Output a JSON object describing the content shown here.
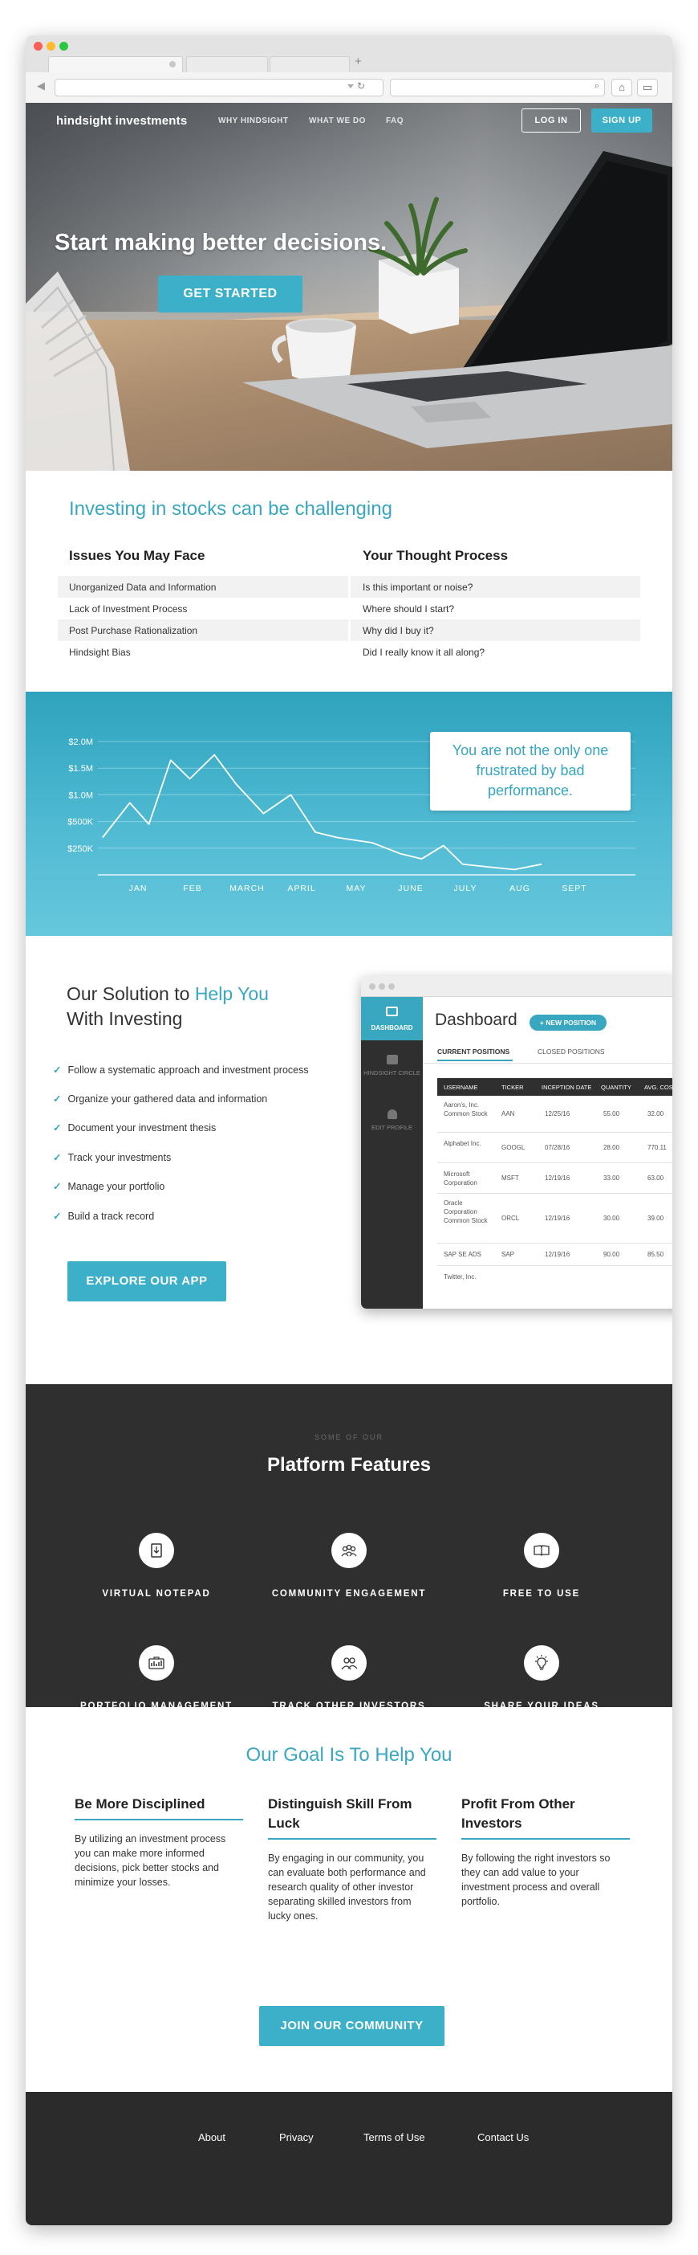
{
  "nav": {
    "logo": "hindsight investments",
    "links": [
      "WHY HINDSIGHT",
      "WHAT WE DO",
      "FAQ"
    ],
    "login": "LOG IN",
    "signup": "SIGN UP"
  },
  "hero": {
    "headline": "Start making better decisions.",
    "cta": "GET STARTED"
  },
  "challenges": {
    "heading": "Investing in stocks can be challenging",
    "col_left": "Issues You May Face",
    "col_right": "Your Thought Process",
    "rows": [
      {
        "issue": "Unorganized Data and Information",
        "thought": "Is this important or noise?"
      },
      {
        "issue": "Lack of Investment Process",
        "thought": "Where should I start?"
      },
      {
        "issue": "Post Purchase Rationalization",
        "thought": "Why did I buy it?"
      },
      {
        "issue": "Hindsight Bias",
        "thought": "Did I really know it all along?"
      }
    ]
  },
  "frustration": {
    "callout": "You are not the only one frustrated by bad performance."
  },
  "chart_data": {
    "type": "line",
    "title": "",
    "xlabel": "",
    "ylabel": "",
    "y_ticks": [
      "$2.0M",
      "$1.5M",
      "$1.0M",
      "$500K",
      "$250K"
    ],
    "y_tick_values": [
      2000000,
      1500000,
      1000000,
      500000,
      0
    ],
    "ylim": [
      0,
      2000000
    ],
    "x_ticks": [
      "JAN",
      "FEB",
      "MARCH",
      "APRIL",
      "MAY",
      "JUNE",
      "JULY",
      "AUG",
      "SEPT"
    ],
    "x": [
      0.35,
      0.85,
      1.2,
      1.6,
      1.95,
      2.4,
      2.8,
      3.3,
      3.8,
      4.25,
      4.65,
      5.3,
      5.8,
      6.2,
      6.6,
      6.95,
      7.4,
      7.9,
      8.4
    ],
    "values": [
      200000,
      850000,
      450000,
      1650000,
      1300000,
      1750000,
      1200000,
      650000,
      1000000,
      300000,
      200000,
      100000,
      -100000,
      -200000,
      50000,
      -300000,
      -350000,
      -400000,
      -300000
    ],
    "grid": true
  },
  "solution": {
    "title_pre": "Our Solution to ",
    "title_accent": "Help You",
    "title_post": "With Investing",
    "checks": [
      "Follow a systematic approach and investment process",
      "Organize your gathered data and information",
      "Document your investment thesis",
      "Track your investments",
      "Manage your portfolio",
      "Build a track record"
    ],
    "cta": "EXPLORE OUR APP",
    "check_icon": "checkmark-icon"
  },
  "app_preview": {
    "title": "Dashboard",
    "new_position": "+ NEW POSITION",
    "sidebar": [
      "DASHBOARD",
      "HINDSIGHT CIRCLE",
      "EDIT PROFILE"
    ],
    "tabs": [
      "CURRENT POSITIONS",
      "CLOSED POSITIONS"
    ],
    "columns": [
      "USERNAME",
      "TICKER",
      "INCEPTION DATE",
      "QUANTITY",
      "AVG. COST"
    ],
    "rows": [
      [
        "Aaron's, Inc. Common Stock",
        "AAN",
        "12/25/16",
        "55.00",
        "32.00"
      ],
      [
        "Alphabet Inc.",
        "GOOGL",
        "07/28/16",
        "28.00",
        "770.11"
      ],
      [
        "Microsoft Corporation",
        "MSFT",
        "12/19/16",
        "33.00",
        "63.00"
      ],
      [
        "Oracle Corporation Common Stock",
        "ORCL",
        "12/19/16",
        "30.00",
        "39.00"
      ],
      [
        "SAP SE ADS",
        "SAP",
        "12/19/16",
        "90.00",
        "85.50"
      ],
      [
        "Twitter, Inc.",
        "",
        "",
        "",
        ""
      ]
    ]
  },
  "features": {
    "pre": "SOME OF OUR",
    "title": "Platform Features",
    "items": [
      {
        "label": "VIRTUAL NOTEPAD",
        "icon": "notepad-icon"
      },
      {
        "label": "COMMUNITY ENGAGEMENT",
        "icon": "community-icon"
      },
      {
        "label": "FREE TO USE",
        "icon": "open-book-icon"
      },
      {
        "label": "PORTFOLIO MANAGEMENT",
        "icon": "portfolio-icon"
      },
      {
        "label": "TRACK OTHER INVESTORS",
        "icon": "people-icon"
      },
      {
        "label": "SHARE YOUR IDEAS",
        "icon": "lightbulb-icon"
      }
    ]
  },
  "goals": {
    "heading": "Our Goal Is To Help You",
    "items": [
      {
        "title": "Be More Disciplined",
        "desc": "By utilizing an investment process you can make more informed decisions, pick better stocks and minimize your losses."
      },
      {
        "title": "Distinguish Skill From Luck",
        "desc": "By engaging in our community, you can evaluate both performance and research quality of other investor separating skilled investors from lucky ones."
      },
      {
        "title": "Profit From Other Investors",
        "desc": "By following the right investors so they can add value to your investment process and overall portfolio."
      }
    ],
    "cta": "JOIN OUR COMMUNITY"
  },
  "footer": {
    "links": [
      "About",
      "Privacy",
      "Terms of Use",
      "Contact Us"
    ]
  },
  "colors": {
    "accent": "#3cb0c9",
    "dark": "#2f2f2f",
    "footer": "#2b2b2b"
  }
}
